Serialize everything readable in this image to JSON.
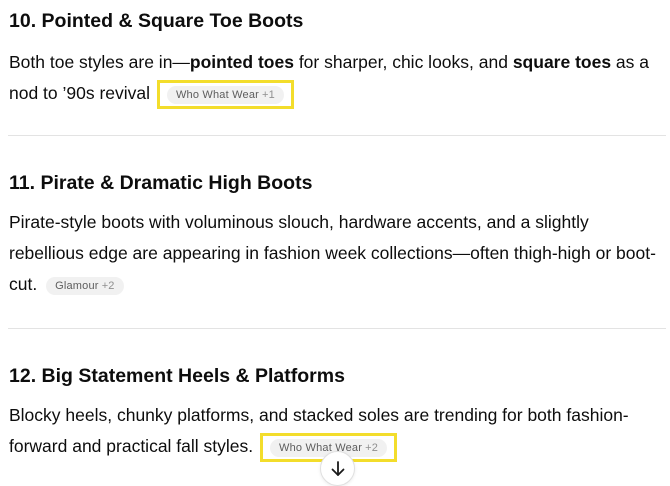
{
  "sections": [
    {
      "heading": "10. Pointed & Square Toe Boots",
      "text_1": "Both toe styles are in—",
      "bold_1": "pointed toes",
      "text_2": " for sharper, chic looks, and ",
      "bold_2": "square toes",
      "text_3": " as a nod to ’90s revival",
      "citation": {
        "source": "Who What Wear",
        "count": "+1",
        "highlighted": true
      }
    },
    {
      "heading": "11. Pirate & Dramatic High Boots",
      "text_1": "Pirate-style boots with voluminous slouch, hardware accents, and a slightly rebellious edge are appearing in fashion week collections—often thigh-high or boot-cut.",
      "citation": {
        "source": "Glamour",
        "count": "+2",
        "highlighted": false
      }
    },
    {
      "heading": "12. Big Statement Heels & Platforms",
      "text_1": "Blocky heels, chunky platforms, and stacked soles are trending for both fashion-forward and practical fall styles.",
      "citation": {
        "source": "Who What Wear",
        "count": "+2",
        "highlighted": true
      }
    }
  ],
  "scroll_button": {
    "icon": "arrow-down-icon"
  },
  "colors": {
    "highlight": "#f3dd2b",
    "chip_bg": "#f1f1f1",
    "divider": "#e3e3e3"
  }
}
